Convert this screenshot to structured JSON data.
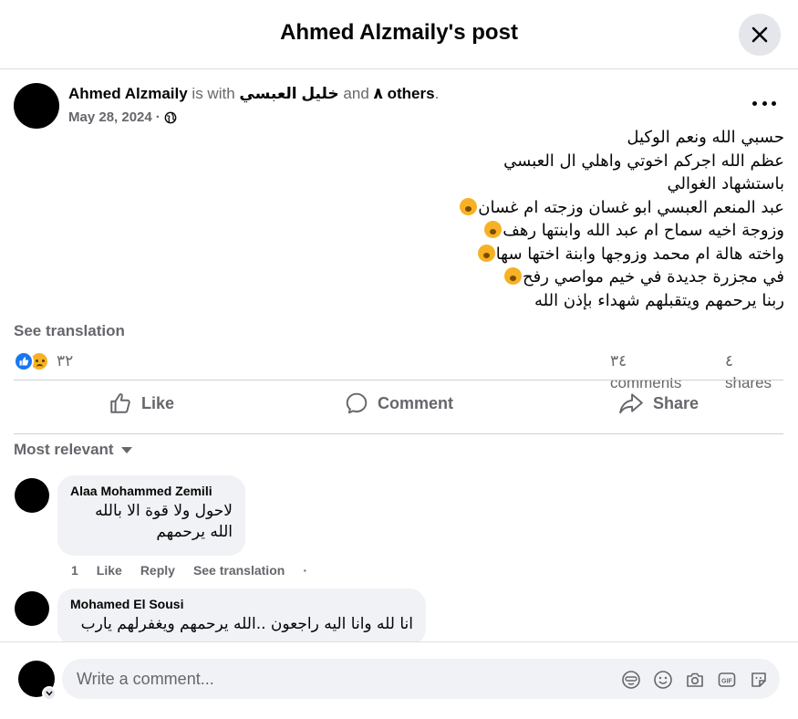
{
  "header": {
    "title": "Ahmed Alzmaily's post",
    "close_icon": "close-icon"
  },
  "post": {
    "author": "Ahmed Alzmaily",
    "is_with_text": "is with",
    "tagged_person": "خليل العبسي",
    "and_text": "and",
    "others": "٨ others",
    "date": "May 28, 2024",
    "privacy_icon": "globe-icon",
    "more_icon": "more-dots-icon",
    "lines": [
      "حسبي الله ونعم الوكيل",
      "عظم الله اجركم اخوتي واهلي ال العبسي",
      "باستشهاد الغوالي",
      "عبد المنعم العبسي ابو غسان وزجته ام غسان",
      "وزوجة اخيه سماح ام عبد الله وابنتها رهف",
      "واخته هالة ام محمد وزوجها وابنة اختها سها",
      "في مجزرة جديدة في خيم مواصي رفح",
      "ربنا يرحمهم ويتقبلهم شهداء بإذن الله"
    ],
    "see_translation": "See translation",
    "reaction_count": "٣٢",
    "comments_count": "٣٤ comments",
    "shares_count": "٤ shares"
  },
  "actions": {
    "like": "Like",
    "comment": "Comment",
    "share": "Share"
  },
  "sort_label": "Most relevant",
  "comments": [
    {
      "author": "Alaa Mohammed Zemili",
      "lines": [
        "لاحول ولا قوة الا بالله",
        "الله يرحمهم"
      ],
      "time": "1",
      "like": "Like",
      "reply": "Reply",
      "see_translation": "See translation"
    },
    {
      "author": "Mohamed El Sousi",
      "lines": [
        "انا لله وانا اليه راجعون ..الله يرحمهم ويغفرلهم يارب"
      ]
    }
  ],
  "composer": {
    "placeholder": "Write a comment..."
  },
  "colors": {
    "like_blue": "#1877f2",
    "muted": "#65676b",
    "bubble": "#f0f2f5"
  }
}
